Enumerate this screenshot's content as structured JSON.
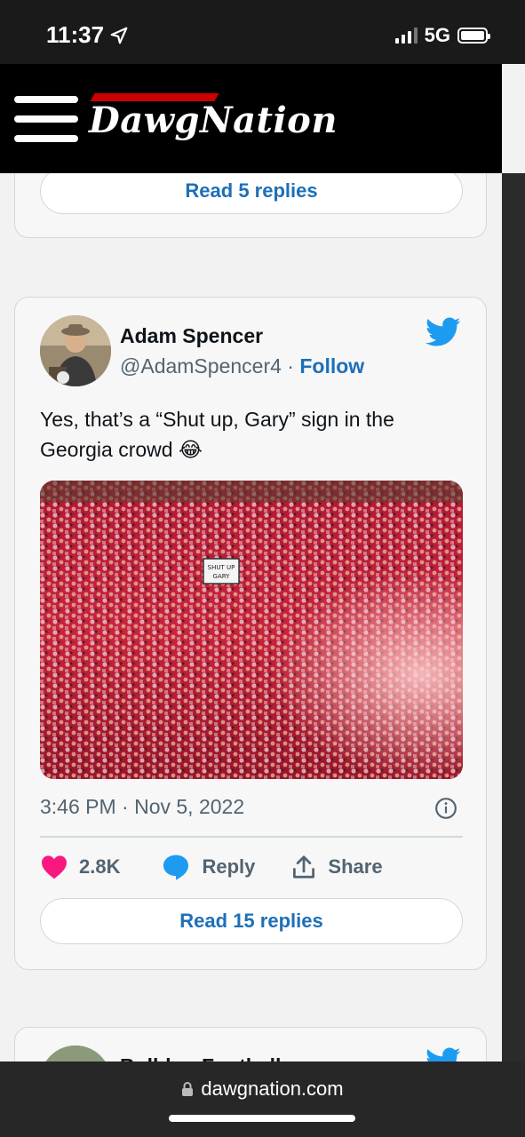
{
  "status_bar": {
    "time": "11:37",
    "network": "5G"
  },
  "header": {
    "logo_text": "DawgNation",
    "brand_color": "#cc0000"
  },
  "previous_card": {
    "read_replies_label": "Read 5 replies"
  },
  "tweet": {
    "author_name": "Adam Spencer",
    "author_handle": "@AdamSpencer4",
    "separator": " · ",
    "follow_label": "Follow",
    "text": "Yes, that’s a “Shut up, Gary” sign in the Georgia crowd 😂",
    "image_sign_text": "SHUT UP GARY",
    "timestamp": "3:46 PM · Nov 5, 2022",
    "likes_count": "2.8K",
    "reply_label": "Reply",
    "share_label": "Share",
    "read_replies_label": "Read 15 replies",
    "accent_color": "#1d9bf0"
  },
  "next_card": {
    "author_name_partial": "Bulldog Football"
  },
  "browser": {
    "url": "dawgnation.com"
  }
}
